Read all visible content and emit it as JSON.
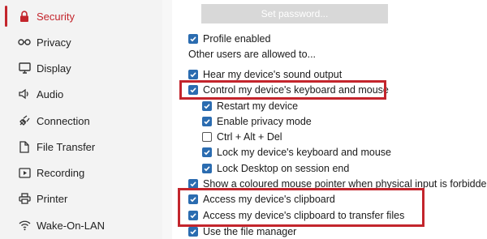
{
  "sidebar": {
    "items": [
      {
        "label": "Security",
        "icon": "lock-icon",
        "active": true
      },
      {
        "label": "Privacy",
        "icon": "glasses-icon"
      },
      {
        "label": "Display",
        "icon": "monitor-icon"
      },
      {
        "label": "Audio",
        "icon": "speaker-icon"
      },
      {
        "label": "Connection",
        "icon": "plug-icon"
      },
      {
        "label": "File Transfer",
        "icon": "file-icon"
      },
      {
        "label": "Recording",
        "icon": "video-icon"
      },
      {
        "label": "Printer",
        "icon": "printer-icon"
      },
      {
        "label": "Wake-On-LAN",
        "icon": "wifi-icon"
      }
    ],
    "accent_color": "#c3252c"
  },
  "main": {
    "set_password_label": "Set password...",
    "profile_enabled": {
      "label": "Profile enabled",
      "checked": true
    },
    "others_allowed_heading": "Other users are allowed to...",
    "permissions": [
      {
        "label": "Hear my device's sound output",
        "checked": true
      },
      {
        "label": "Control my device's keyboard and mouse",
        "checked": true
      },
      {
        "label": "Restart my device",
        "checked": true
      },
      {
        "label": "Enable privacy mode",
        "checked": true
      },
      {
        "label": "Ctrl + Alt + Del",
        "checked": false
      },
      {
        "label": "Lock my device's keyboard and mouse",
        "checked": true
      },
      {
        "label": "Lock Desktop on session end",
        "checked": true
      },
      {
        "label": "Show a coloured mouse pointer when physical input is forbidden",
        "checked": true
      },
      {
        "label": "Access my device's clipboard",
        "checked": true
      },
      {
        "label": "Access my device's clipboard to transfer files",
        "checked": true
      },
      {
        "label": "Use the file manager",
        "checked": true
      }
    ],
    "checkbox_color": "#2b6cb0",
    "highlight_color": "#c3252c"
  }
}
